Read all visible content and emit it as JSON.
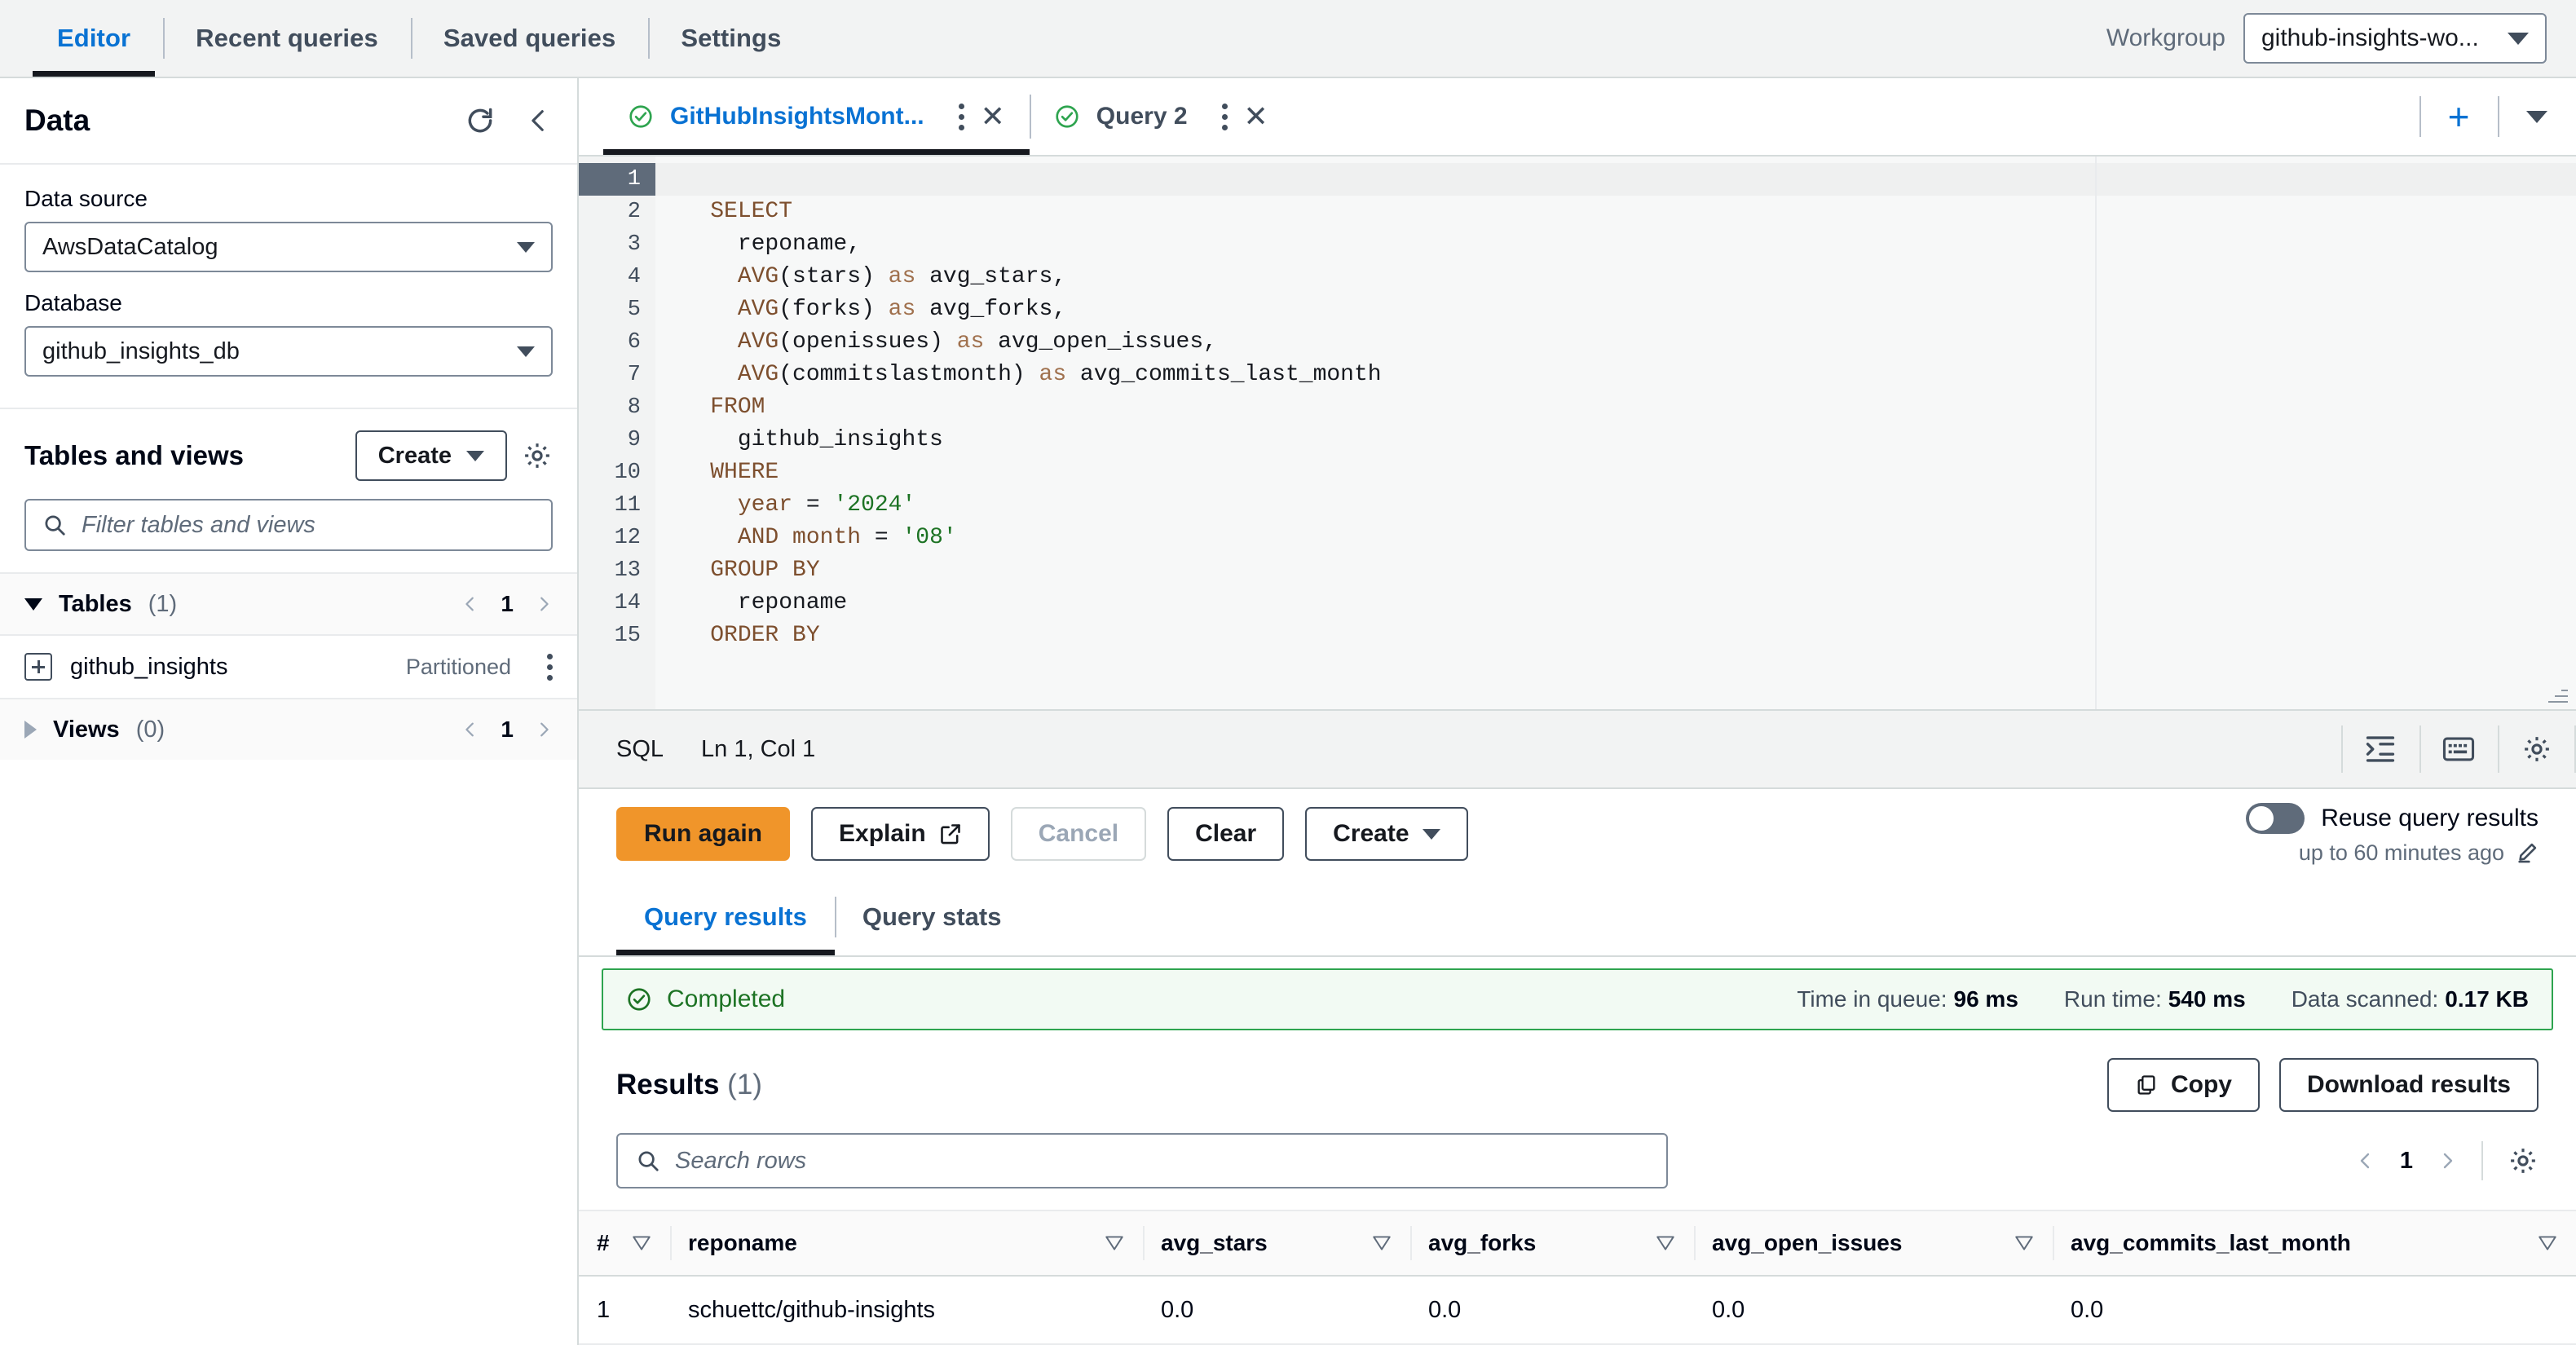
{
  "topnav": {
    "tabs": [
      {
        "label": "Editor",
        "active": true
      },
      {
        "label": "Recent queries",
        "active": false
      },
      {
        "label": "Saved queries",
        "active": false
      },
      {
        "label": "Settings",
        "active": false
      }
    ],
    "workgroup_label": "Workgroup",
    "workgroup_value": "github-insights-wo..."
  },
  "sidebar": {
    "title": "Data",
    "data_source_label": "Data source",
    "data_source_value": "AwsDataCatalog",
    "database_label": "Database",
    "database_value": "github_insights_db",
    "tables_views_title": "Tables and views",
    "create_label": "Create",
    "filter_placeholder": "Filter tables and views",
    "tables_group": {
      "label": "Tables",
      "count": "(1)",
      "page": "1"
    },
    "table_item": {
      "name": "github_insights",
      "meta": "Partitioned"
    },
    "views_group": {
      "label": "Views",
      "count": "(0)",
      "page": "1"
    }
  },
  "query_tabs": [
    {
      "label": "GitHubInsightsMont...",
      "active": true
    },
    {
      "label": "Query 2",
      "active": false
    }
  ],
  "editor": {
    "lines": [
      {
        "n": "1",
        "html": "",
        "current": true
      },
      {
        "n": "2",
        "html": "    <span class='kw'>SELECT</span>"
      },
      {
        "n": "3",
        "html": "      reponame,"
      },
      {
        "n": "4",
        "html": "      <span class='kw'>AVG</span>(stars) <span class='as'>as</span> avg_stars,"
      },
      {
        "n": "5",
        "html": "      <span class='kw'>AVG</span>(forks) <span class='as'>as</span> avg_forks,"
      },
      {
        "n": "6",
        "html": "      <span class='kw'>AVG</span>(openissues) <span class='as'>as</span> avg_open_issues,"
      },
      {
        "n": "7",
        "html": "      <span class='kw'>AVG</span>(commitslastmonth) <span class='as'>as</span> avg_commits_last_month"
      },
      {
        "n": "8",
        "html": "    <span class='kw'>FROM</span>"
      },
      {
        "n": "9",
        "html": "      github_insights"
      },
      {
        "n": "10",
        "html": "    <span class='kw'>WHERE</span>"
      },
      {
        "n": "11",
        "html": "      <span class='kw'>year</span> = <span class='str'>'2024'</span>"
      },
      {
        "n": "12",
        "html": "      <span class='kw'>AND month</span> = <span class='str'>'08'</span>"
      },
      {
        "n": "13",
        "html": "    <span class='kw'>GROUP BY</span>"
      },
      {
        "n": "14",
        "html": "      reponame"
      },
      {
        "n": "15",
        "html": "    <span class='kw'>ORDER BY</span>"
      }
    ],
    "status_lang": "SQL",
    "status_position": "Ln 1, Col 1"
  },
  "actions": {
    "run_again": "Run again",
    "explain": "Explain",
    "cancel": "Cancel",
    "clear": "Clear",
    "create": "Create",
    "reuse_label": "Reuse query results",
    "reuse_sub": "up to 60 minutes ago"
  },
  "result_tabs": [
    {
      "label": "Query results",
      "active": true
    },
    {
      "label": "Query stats",
      "active": false
    }
  ],
  "status_banner": {
    "state": "Completed",
    "metrics": [
      {
        "label": "Time in queue:",
        "value": "96 ms"
      },
      {
        "label": "Run time:",
        "value": "540 ms"
      },
      {
        "label": "Data scanned:",
        "value": "0.17 KB"
      }
    ]
  },
  "results": {
    "title": "Results",
    "count": "(1)",
    "copy_label": "Copy",
    "download_label": "Download results",
    "search_placeholder": "Search rows",
    "page": "1",
    "columns": [
      "#",
      "reponame",
      "avg_stars",
      "avg_forks",
      "avg_open_issues",
      "avg_commits_last_month"
    ],
    "rows": [
      [
        "1",
        "schuettc/github-insights",
        "0.0",
        "0.0",
        "0.0",
        "0.0"
      ]
    ]
  },
  "colors": {
    "accent_blue": "#0972d3",
    "run_orange": "#f0952a",
    "success_green": "#1d7324",
    "banner_bg": "#f2faf3"
  }
}
